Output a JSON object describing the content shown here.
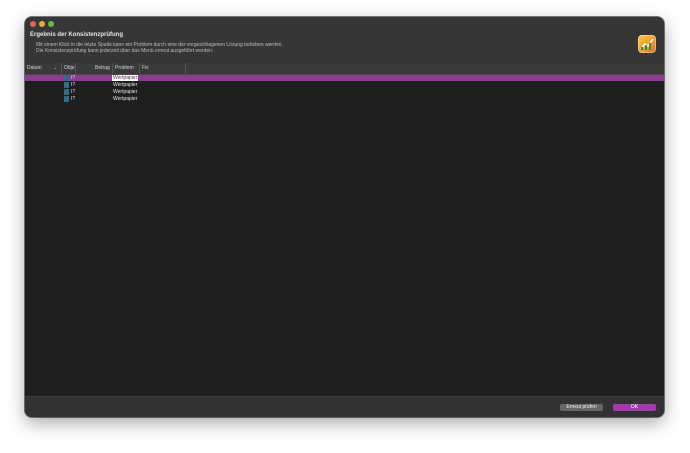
{
  "window": {
    "traffic_lights": [
      "close",
      "minimize",
      "maximize"
    ]
  },
  "header": {
    "title": "Ergebnis der Konsistenzprüfung",
    "line1": "Mit einem Klick in die letzte Spalte kann ein Problem durch eine der vorgeschlagenen Lösung behoben werden.",
    "line2": "Die Konsistenzprüfung kann jederzeit über das Menü erneut ausgeführt werden.",
    "app_icon": "portfolio-chart-icon"
  },
  "table": {
    "columns": [
      {
        "label": "Datum"
      },
      {
        "label": "Obje"
      },
      {
        "label": "Betrag"
      },
      {
        "label": "Problem"
      },
      {
        "label": "Fix"
      }
    ],
    "sort_indicator": "⌄",
    "rows": [
      {
        "object": "I?",
        "problem": "Wertpapier",
        "selected": true
      },
      {
        "object": "I?",
        "problem": "Wertpapier",
        "selected": false
      },
      {
        "object": "I?",
        "problem": "Wertpapier",
        "selected": false
      },
      {
        "object": "I?",
        "problem": "Wertpapier",
        "selected": false
      }
    ]
  },
  "footer": {
    "recheck_label": "Erneut prüfen",
    "ok_label": "OK"
  },
  "colors": {
    "accent": "#a23cad",
    "selection": "#8c3b8f",
    "row_icon": "#2e6a8e"
  }
}
